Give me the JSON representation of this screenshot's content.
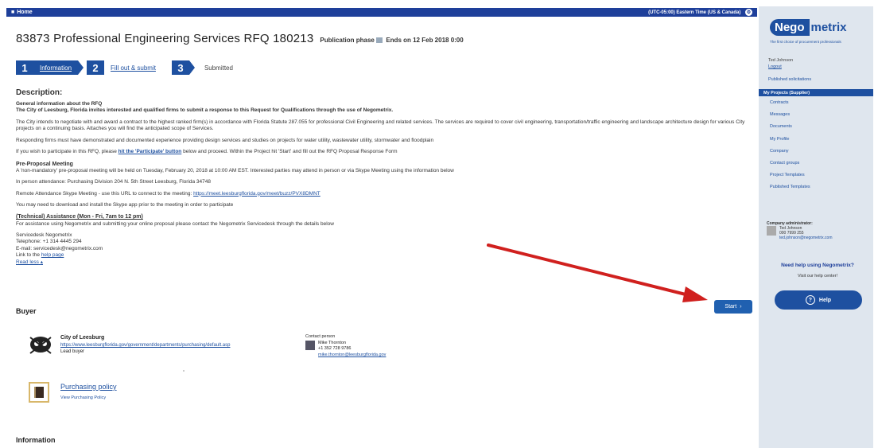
{
  "topbar": {
    "home": "Home",
    "timezone": "(UTC-05:00) Eastern Time (US & Canada)"
  },
  "title": "83873 Professional Engineering Services RFQ 180213",
  "phase": {
    "label": "Publication phase",
    "ends": "Ends on 12 Feb 2018 0:00"
  },
  "steps": [
    {
      "num": "1",
      "label": "Information"
    },
    {
      "num": "2",
      "label": "Fill out & submit"
    },
    {
      "num": "3",
      "label": "Submitted"
    }
  ],
  "description": {
    "heading": "Description:",
    "gen_head": "General information about the RFQ",
    "gen_text": "The City of Leesburg, Florida invites interested and qualified firms to submit a response to this Request for Qualifications through the use of Negometrix.",
    "intent": "The City intends to negotiate with and award a contract to the highest ranked firm(s) in accordance with Florida Statute 287.055 for professional Civil Engineering and related services. The services are required to cover civil engineering, transportation/traffic engineering and landscape architecture design for various City projects on a continuing basis. Attaches you will find the anticipated scope of Services.",
    "responding": "Responding firms must have demonstrated and documented experience providing design services and studies on projects for water utility, wastewater utility, stormwater and floodplain",
    "participate_pre": "If you wish to participate in this RFQ, please",
    "participate_link": "hit the 'Participate' button",
    "participate_post": "below and proceed. Within the Project hit 'Start' and fill out the RFQ Proposal Response Form",
    "pre_head": "Pre-Proposal Meeting",
    "pre_text": "A 'non-mandatory' pre-proposal meeting will be held on Tuesday, February 20, 2018 at 10:00 AM EST. Interested parties may attend in person or via Skype Meeting using the information below",
    "in_person": "In person attendance: Purchasing Division 204 N. 5th Street Leesburg, Florida 34748",
    "remote": "Remote Attendance Skype Meeting - use this URL to connect to the meeting:",
    "remote_link": "https://meet.leesburgflorida.gov/meet/buzz/PVX8DMNT",
    "skype": "You may need to download and install the Skype app prior to the meeting in order to participate",
    "tech_head": "(Technical) Assistance (Mon - Fri, 7am to 12 pm)",
    "tech_text": "For assistance using Negometrix and submitting your online proposal please contact the Negometrix Servicedesk through the details below",
    "sd_line1": "Servicedesk Negometrix",
    "sd_line2": "Telephone: +1 314 4445 294",
    "sd_line3": "E-mail: servicedesk@negometrix.com",
    "sd_line4_pre": "Link to the",
    "sd_line4_link": "help page",
    "read_less": "Read less"
  },
  "buyer": {
    "heading": "Buyer",
    "org": "City of Leesburg",
    "url": "https://www.leesburgflorida.gov/government/departments/purchasing/default.asp",
    "role": "Lead buyer",
    "contact_label": "Contact person",
    "contact_name": "Mike Thornton",
    "contact_phone": "+1 352 728 9786",
    "contact_email": "mike.thornton@leesburgflorida.gov"
  },
  "policy": {
    "title": "Purchasing policy",
    "sub": "View Purchasing Policy"
  },
  "info_head": "Information",
  "start_label": "Start",
  "sidebar": {
    "logo_a": "Nego",
    "logo_b": "metrix",
    "tagline": "The first choice of procurement professionals",
    "user": "Ted Johnson",
    "logout": "Logout",
    "published": "Published solicitations",
    "projects_bar": "My Projects (Supplier)",
    "menu": [
      "Contracts",
      "Messages",
      "Documents",
      "My Profile",
      "Company",
      "Contact groups",
      "Project Templates",
      "Published Templates"
    ],
    "company_label": "Company administrator:",
    "company_name": "Ted Johnson",
    "company_phone": "000 7999 255",
    "company_email": "ted.johnson@negometrix.com",
    "help_head": "Need help using Negometrix?",
    "help_sub": "Visit our help center!",
    "help_btn": "Help"
  },
  "colors": {
    "brand": "#1e50a0",
    "topbar": "#1e3f9a",
    "arrow": "#d0201e",
    "sidebar_bg": "#dfe6ee"
  }
}
